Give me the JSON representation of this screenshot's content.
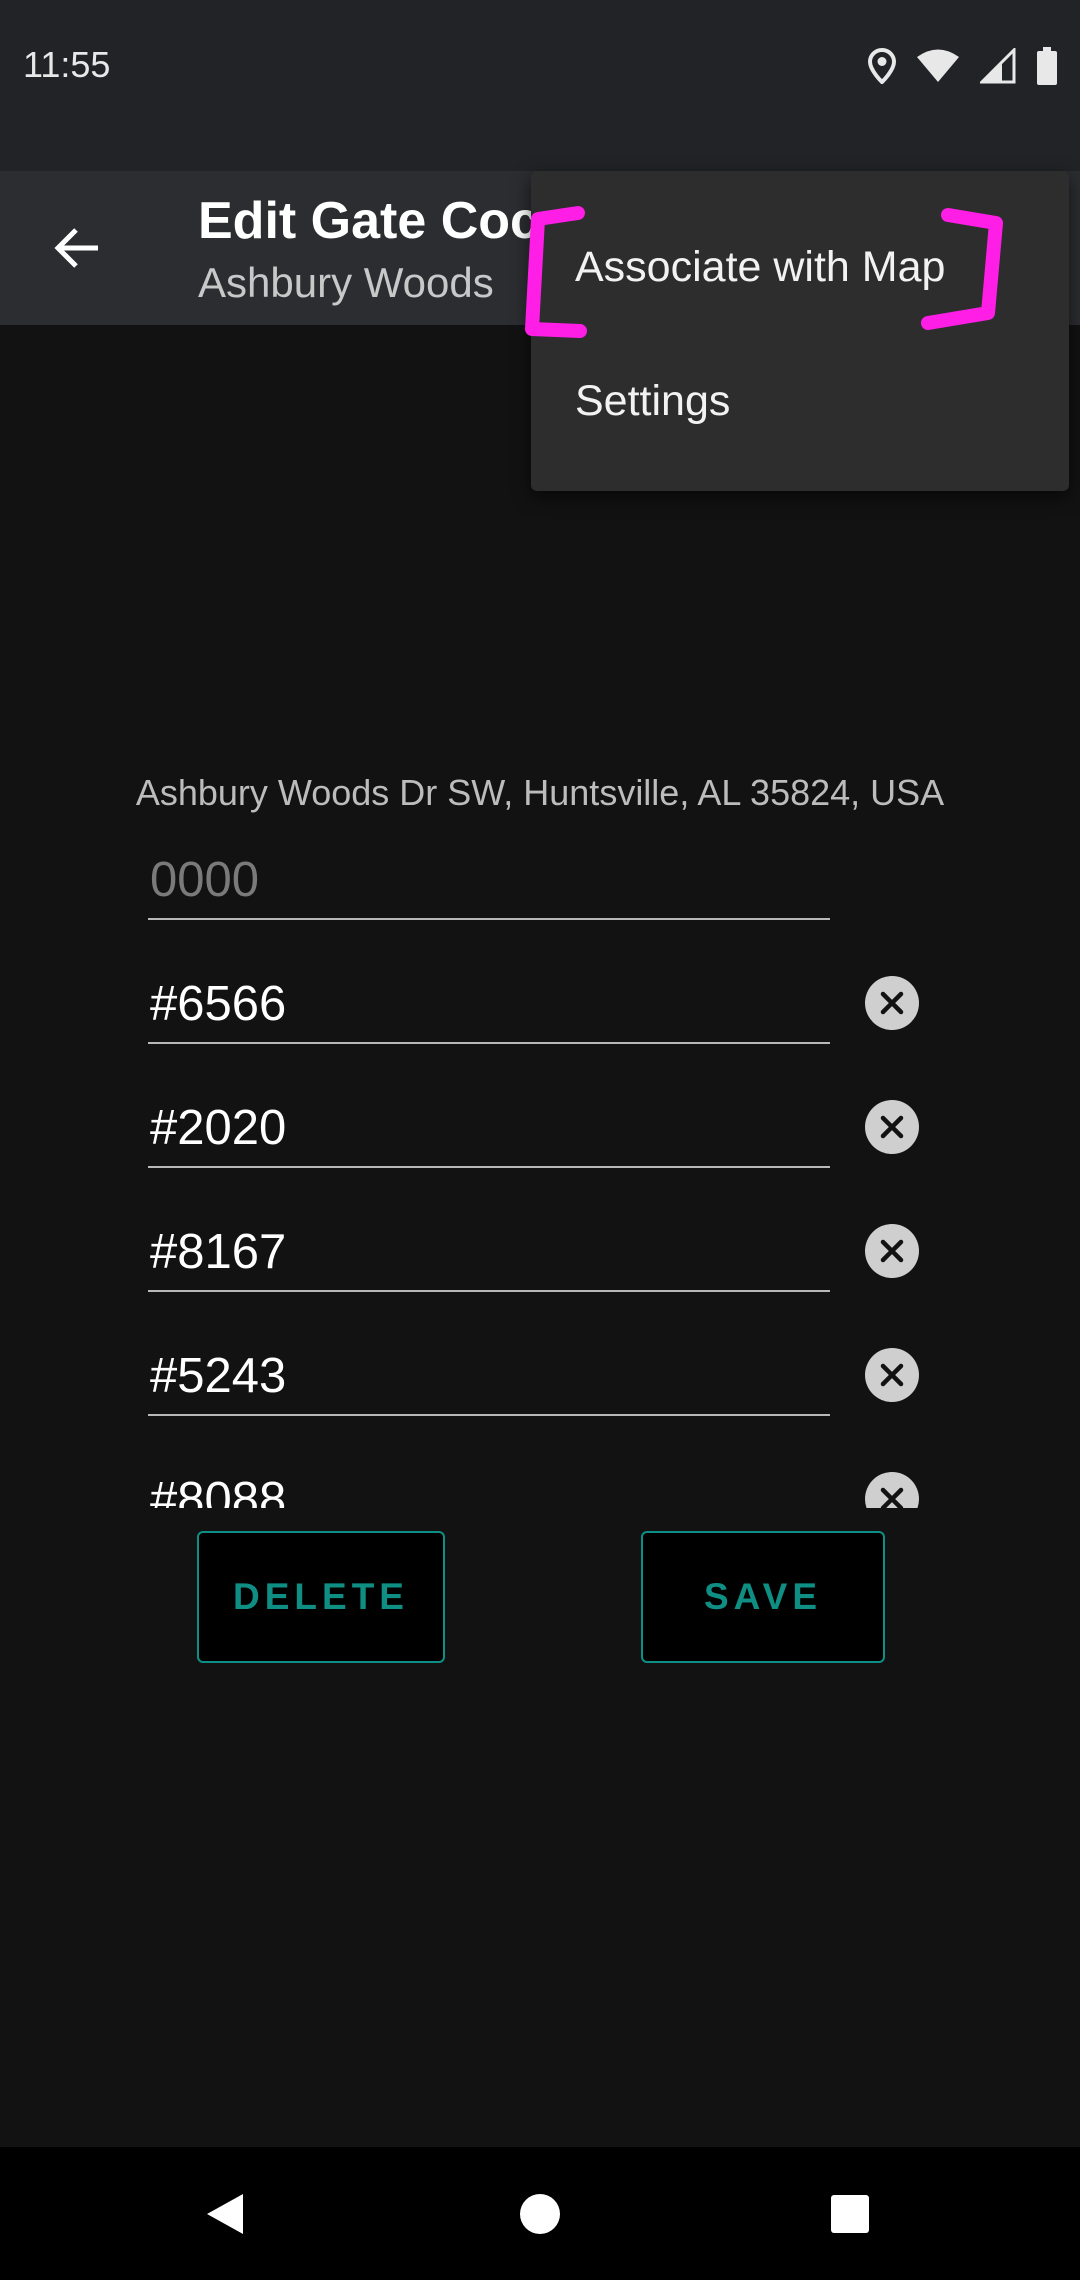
{
  "status_bar": {
    "time": "11:55",
    "icons": [
      "location-icon",
      "wifi-icon",
      "signal-icon",
      "battery-icon"
    ]
  },
  "app_bar": {
    "back_icon": "arrow-left-icon",
    "title": "Edit Gate Coc",
    "subtitle": "Ashbury Woods"
  },
  "overflow_menu": {
    "items": [
      {
        "label": "Associate with Map"
      },
      {
        "label": "Settings"
      }
    ],
    "annotation_color": "#ff1ee6"
  },
  "address": "Ashbury Woods Dr SW, Huntsville, AL 35824, USA",
  "code_input": {
    "placeholder": "0000"
  },
  "codes": [
    {
      "value": "#6566"
    },
    {
      "value": "#2020"
    },
    {
      "value": "#8167"
    },
    {
      "value": "#5243"
    },
    {
      "value": "#8088"
    }
  ],
  "buttons": {
    "delete": "DELETE",
    "save": "SAVE"
  },
  "colors": {
    "accent": "#0f8e84",
    "app_bar": "#2b2d31",
    "background": "#121212"
  },
  "nav_bar": {
    "icons": [
      "back-triangle-icon",
      "home-circle-icon",
      "recents-square-icon"
    ]
  }
}
